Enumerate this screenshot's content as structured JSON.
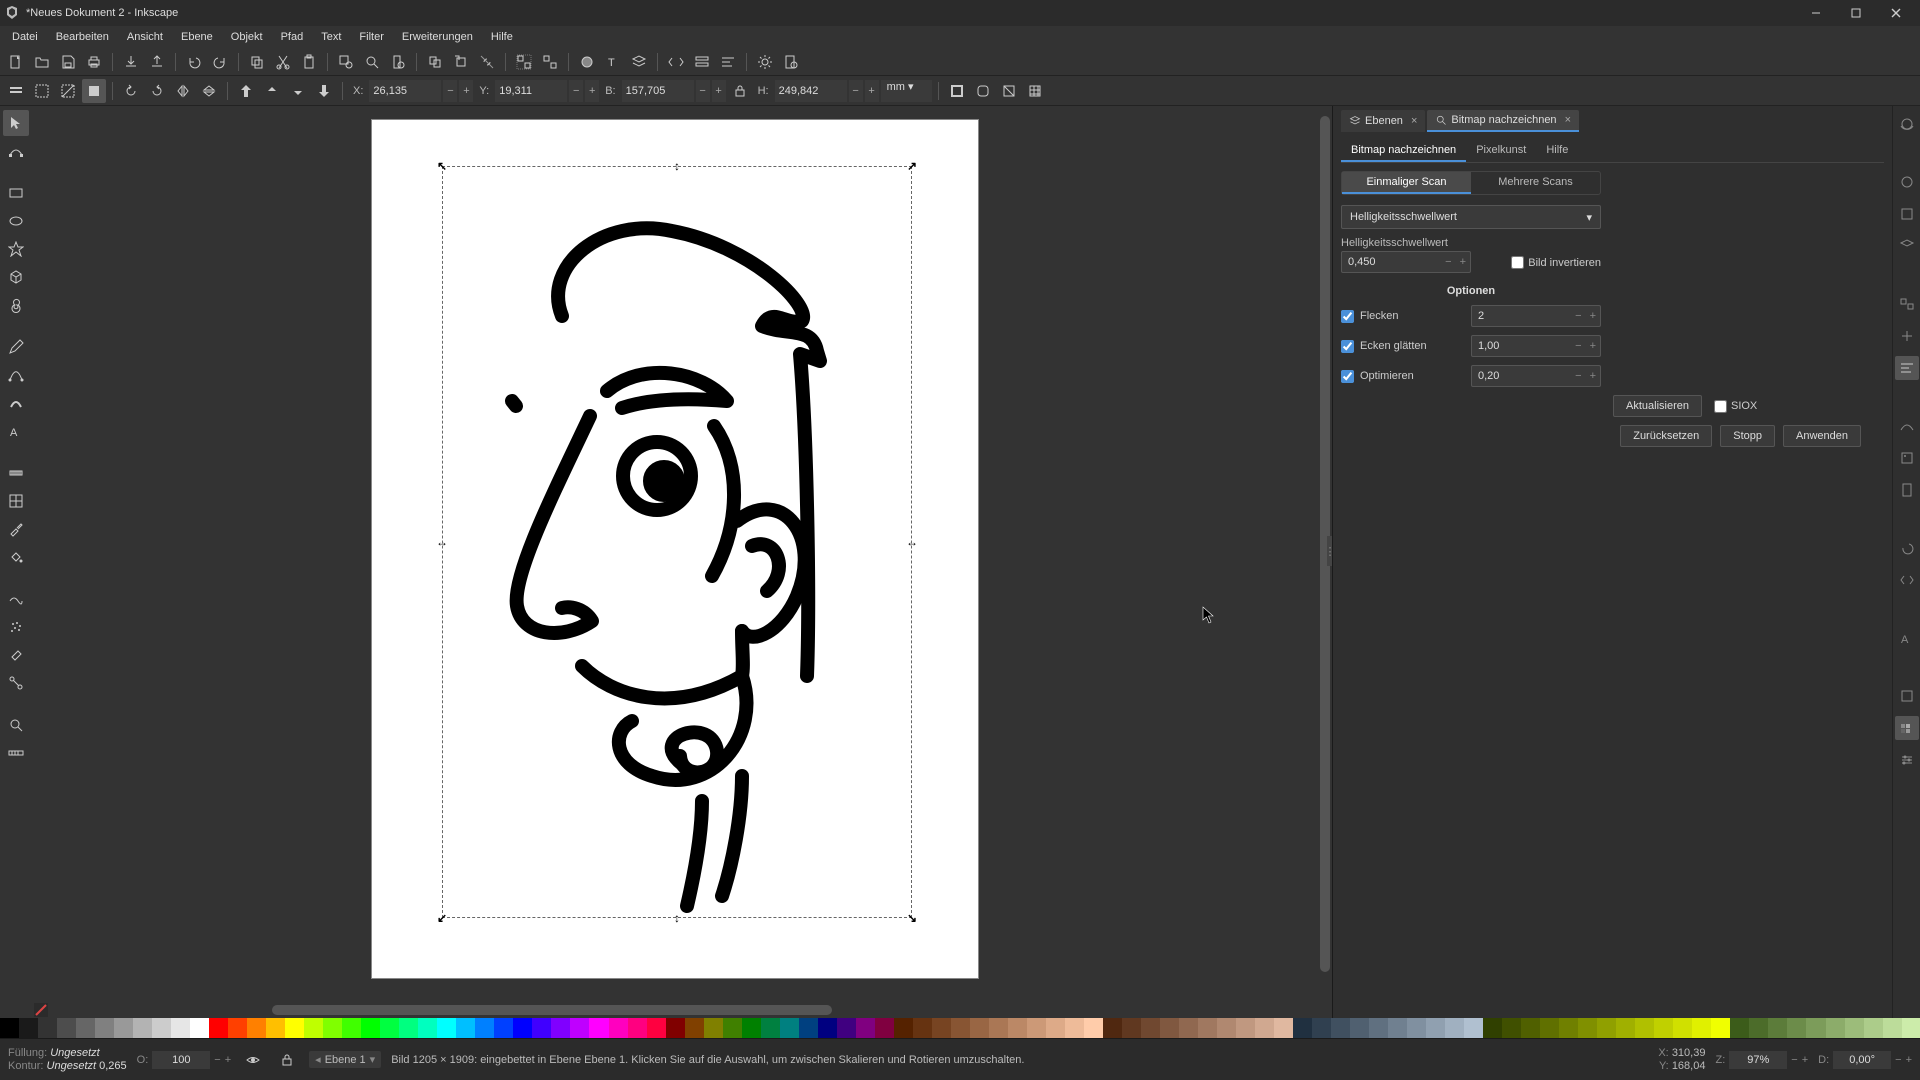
{
  "window": {
    "title": "*Neues Dokument 2 - Inkscape"
  },
  "menu": [
    "Datei",
    "Bearbeiten",
    "Ansicht",
    "Ebene",
    "Objekt",
    "Pfad",
    "Text",
    "Filter",
    "Erweiterungen",
    "Hilfe"
  ],
  "options_bar": {
    "x_label": "X:",
    "x_value": "26,135",
    "y_label": "Y:",
    "y_value": "19,311",
    "b_label": "B:",
    "b_value": "157,705",
    "h_label": "H:",
    "h_value": "249,842",
    "unit": "mm"
  },
  "dock": {
    "tab_layers": "Ebenen",
    "tab_bitmap": "Bitmap nachzeichnen",
    "subtabs": {
      "trace": "Bitmap nachzeichnen",
      "pixelart": "Pixelkunst",
      "help": "Hilfe"
    },
    "seg": {
      "single": "Einmaliger Scan",
      "multi": "Mehrere Scans"
    },
    "method_label": "Helligkeitsschwellwert",
    "threshold_label": "Helligkeitsschwellwert",
    "threshold_value": "0,450",
    "invert_label": "Bild invertieren",
    "options_header": "Optionen",
    "opt_speckles": {
      "label": "Flecken",
      "value": "2"
    },
    "opt_corners": {
      "label": "Ecken glätten",
      "value": "1,00"
    },
    "opt_optimize": {
      "label": "Optimieren",
      "value": "0,20"
    },
    "update_btn": "Aktualisieren",
    "siox_label": "SIOX",
    "reset_btn": "Zurücksetzen",
    "stop_btn": "Stopp",
    "apply_btn": "Anwenden"
  },
  "status": {
    "fill_label": "Füllung:",
    "fill_value": "Ungesetzt",
    "stroke_label": "Kontur:",
    "stroke_value": "Ungesetzt",
    "stroke_width": "0,265",
    "opacity_label": "O:",
    "opacity_value": "100",
    "layer_label": "Ebene 1",
    "object_info": "Bild  1205 × 1909: eingebettet in Ebene Ebene 1. Klicken Sie auf die Auswahl, um zwischen Skalieren und Rotieren umzuschalten.",
    "coord_x_label": "X:",
    "coord_x": "310,39",
    "coord_y_label": "Y:",
    "coord_y": "168,04",
    "zoom_label": "Z:",
    "zoom": "97%",
    "rot_label": "D:",
    "rot": "0,00°"
  },
  "palette": [
    "#000000",
    "#1a1a1a",
    "#333333",
    "#4d4d4d",
    "#666666",
    "#808080",
    "#999999",
    "#b3b3b3",
    "#cccccc",
    "#e6e6e6",
    "#ffffff",
    "#ff0000",
    "#ff4000",
    "#ff8000",
    "#ffbf00",
    "#ffff00",
    "#bfff00",
    "#80ff00",
    "#40ff00",
    "#00ff00",
    "#00ff40",
    "#00ff80",
    "#00ffbf",
    "#00ffff",
    "#00bfff",
    "#0080ff",
    "#0040ff",
    "#0000ff",
    "#4000ff",
    "#8000ff",
    "#bf00ff",
    "#ff00ff",
    "#ff00bf",
    "#ff0080",
    "#ff0040",
    "#800000",
    "#804000",
    "#808000",
    "#408000",
    "#008000",
    "#008040",
    "#008080",
    "#004080",
    "#000080",
    "#400080",
    "#800080",
    "#800040",
    "#552200",
    "#663311",
    "#774422",
    "#885533",
    "#996644",
    "#aa7755",
    "#bb8866",
    "#cc9977",
    "#ddaa88",
    "#eebb99",
    "#ffccaa",
    "#502810",
    "#603820",
    "#704830",
    "#805840",
    "#906850",
    "#a07860",
    "#b08870",
    "#c09880",
    "#d0a890",
    "#e0b8a0",
    "#203040",
    "#304050",
    "#405060",
    "#506070",
    "#607080",
    "#708090",
    "#8090a0",
    "#90a0b0",
    "#a0b0c0",
    "#b0c0d0",
    "#304000",
    "#405000",
    "#506000",
    "#607000",
    "#708000",
    "#809000",
    "#90a000",
    "#a0b000",
    "#b0c000",
    "#c0d000",
    "#d0e000",
    "#e0f000",
    "#f0ff00",
    "#3c5c1a",
    "#4c6c2a",
    "#5c7c3a",
    "#6c8c4a",
    "#7c9c5a",
    "#8cac6a",
    "#9cbc7a",
    "#accc8a",
    "#bcdc9a",
    "#ccecaa"
  ]
}
